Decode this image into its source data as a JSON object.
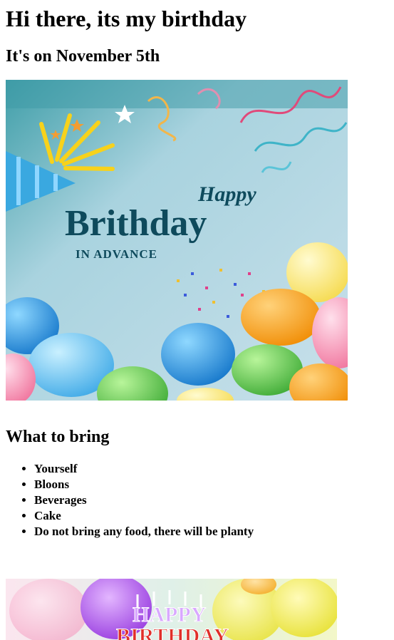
{
  "header": {
    "title": "Hi there, its my birthday",
    "subtitle": "It's on November 5th"
  },
  "card": {
    "line_happy": "Happy",
    "line_main": "Brithday",
    "line_small": "IN ADVANCE",
    "text_color": "#0e4a5c"
  },
  "bring": {
    "heading": "What to bring",
    "items": [
      "Yourself",
      "Bloons",
      "Beverages",
      "Cake",
      "Do not bring any food, there will be planty"
    ]
  },
  "card2": {
    "line_top": "HAPPY",
    "line_bottom": "BIRTHDAY"
  }
}
